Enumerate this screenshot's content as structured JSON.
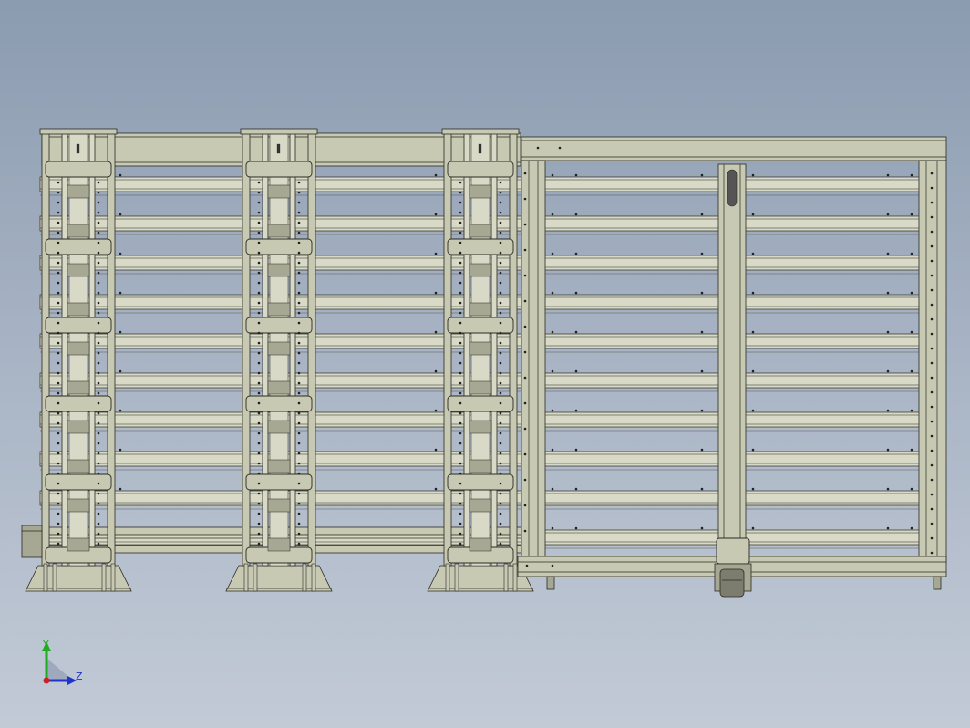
{
  "view": {
    "axis_triad": {
      "y_label": "Y",
      "z_label": "Z",
      "y_color": "#22aa22",
      "z_color": "#2233cc",
      "origin_color": "#cc2222"
    }
  },
  "colors": {
    "metal": "#c8c9b3",
    "metal_light": "#d8d9c6",
    "metal_dark": "#a7a893",
    "line": "#2a2a22",
    "background_top": "#8b9bb0",
    "background_bottom": "#c2cad6"
  },
  "model": {
    "rack_columns": 3,
    "shelf_levels": 10,
    "transfer_unit": "gantry-with-carriage"
  }
}
